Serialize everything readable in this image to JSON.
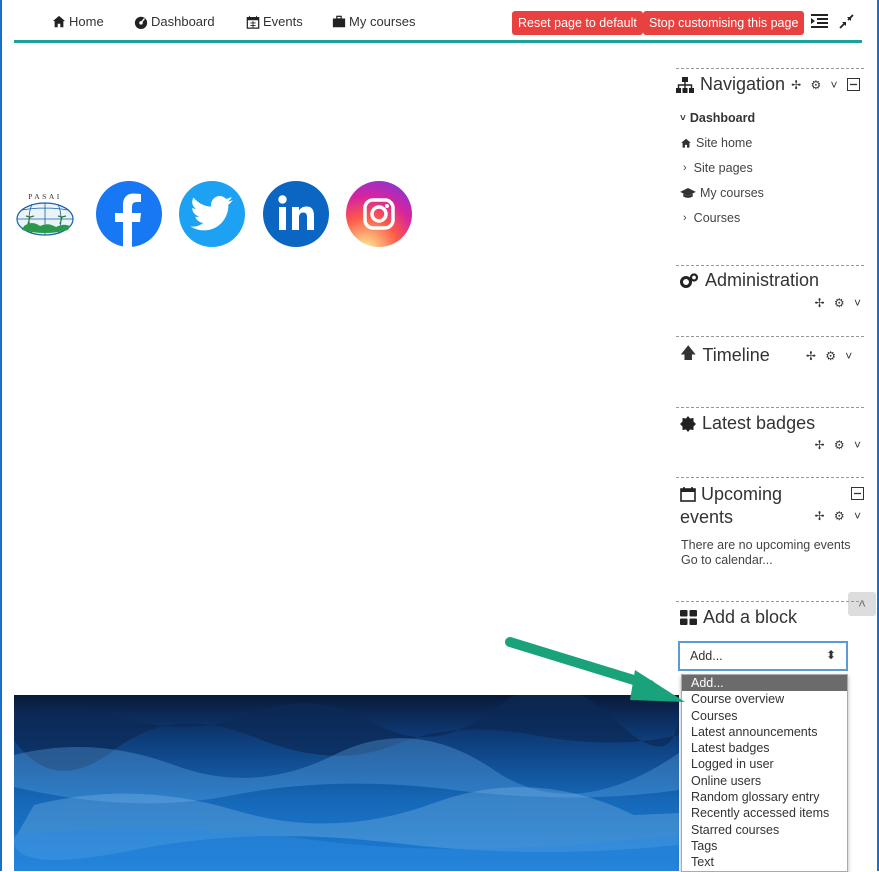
{
  "topnav": {
    "home": "Home",
    "dashboard": "Dashboard",
    "events": "Events",
    "mycourses": "My courses",
    "reset_label": "Reset page to default",
    "stop_label": "Stop customising this page"
  },
  "logo_text": "PASAI",
  "navigation": {
    "title": "Navigation",
    "items": [
      "Dashboard",
      "Site home",
      "Site pages",
      "My courses",
      "Courses"
    ]
  },
  "administration": {
    "title": "Administration"
  },
  "timeline": {
    "title": "Timeline"
  },
  "badges": {
    "title": "Latest badges"
  },
  "upcoming": {
    "title_line1": "Upcoming",
    "title_line2": "events",
    "empty_text": "There are no upcoming events",
    "calendar_link": "Go to calendar..."
  },
  "addblock": {
    "title": "Add a block",
    "selected": "Add...",
    "options": [
      "Add...",
      "Course overview",
      "Courses",
      "Latest announcements",
      "Latest badges",
      "Logged in user",
      "Online users",
      "Random glossary entry",
      "Recently accessed items",
      "Starred courses",
      "Tags",
      "Text"
    ]
  },
  "colors": {
    "accent": "#1aa39a",
    "button_red": "#e9413f",
    "annotation_arrow": "#1aa37a"
  }
}
